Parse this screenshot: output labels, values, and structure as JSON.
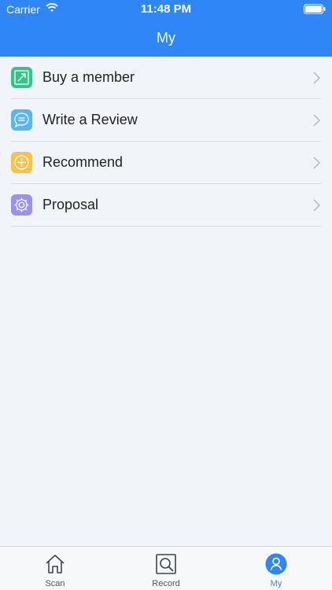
{
  "status_bar": {
    "carrier": "Carrier",
    "time": "11:48 PM"
  },
  "header": {
    "title": "My"
  },
  "menu": {
    "items": [
      {
        "label": "Buy a member",
        "icon": "trend-up-icon",
        "color": "#33c489"
      },
      {
        "label": "Write a Review",
        "icon": "chat-bubble-icon",
        "color": "#5ab6f0"
      },
      {
        "label": "Recommend",
        "icon": "plus-circle-icon",
        "color": "#f9c24a"
      },
      {
        "label": "Proposal",
        "icon": "gear-icon",
        "color": "#9a92ee"
      }
    ]
  },
  "tabbar": {
    "tabs": [
      {
        "label": "Scan",
        "icon": "home-icon",
        "active": false
      },
      {
        "label": "Record",
        "icon": "search-document-icon",
        "active": false
      },
      {
        "label": "My",
        "icon": "user-icon",
        "active": true
      }
    ]
  },
  "colors": {
    "accent": "#2f86f6",
    "background": "#f1f4f8"
  }
}
